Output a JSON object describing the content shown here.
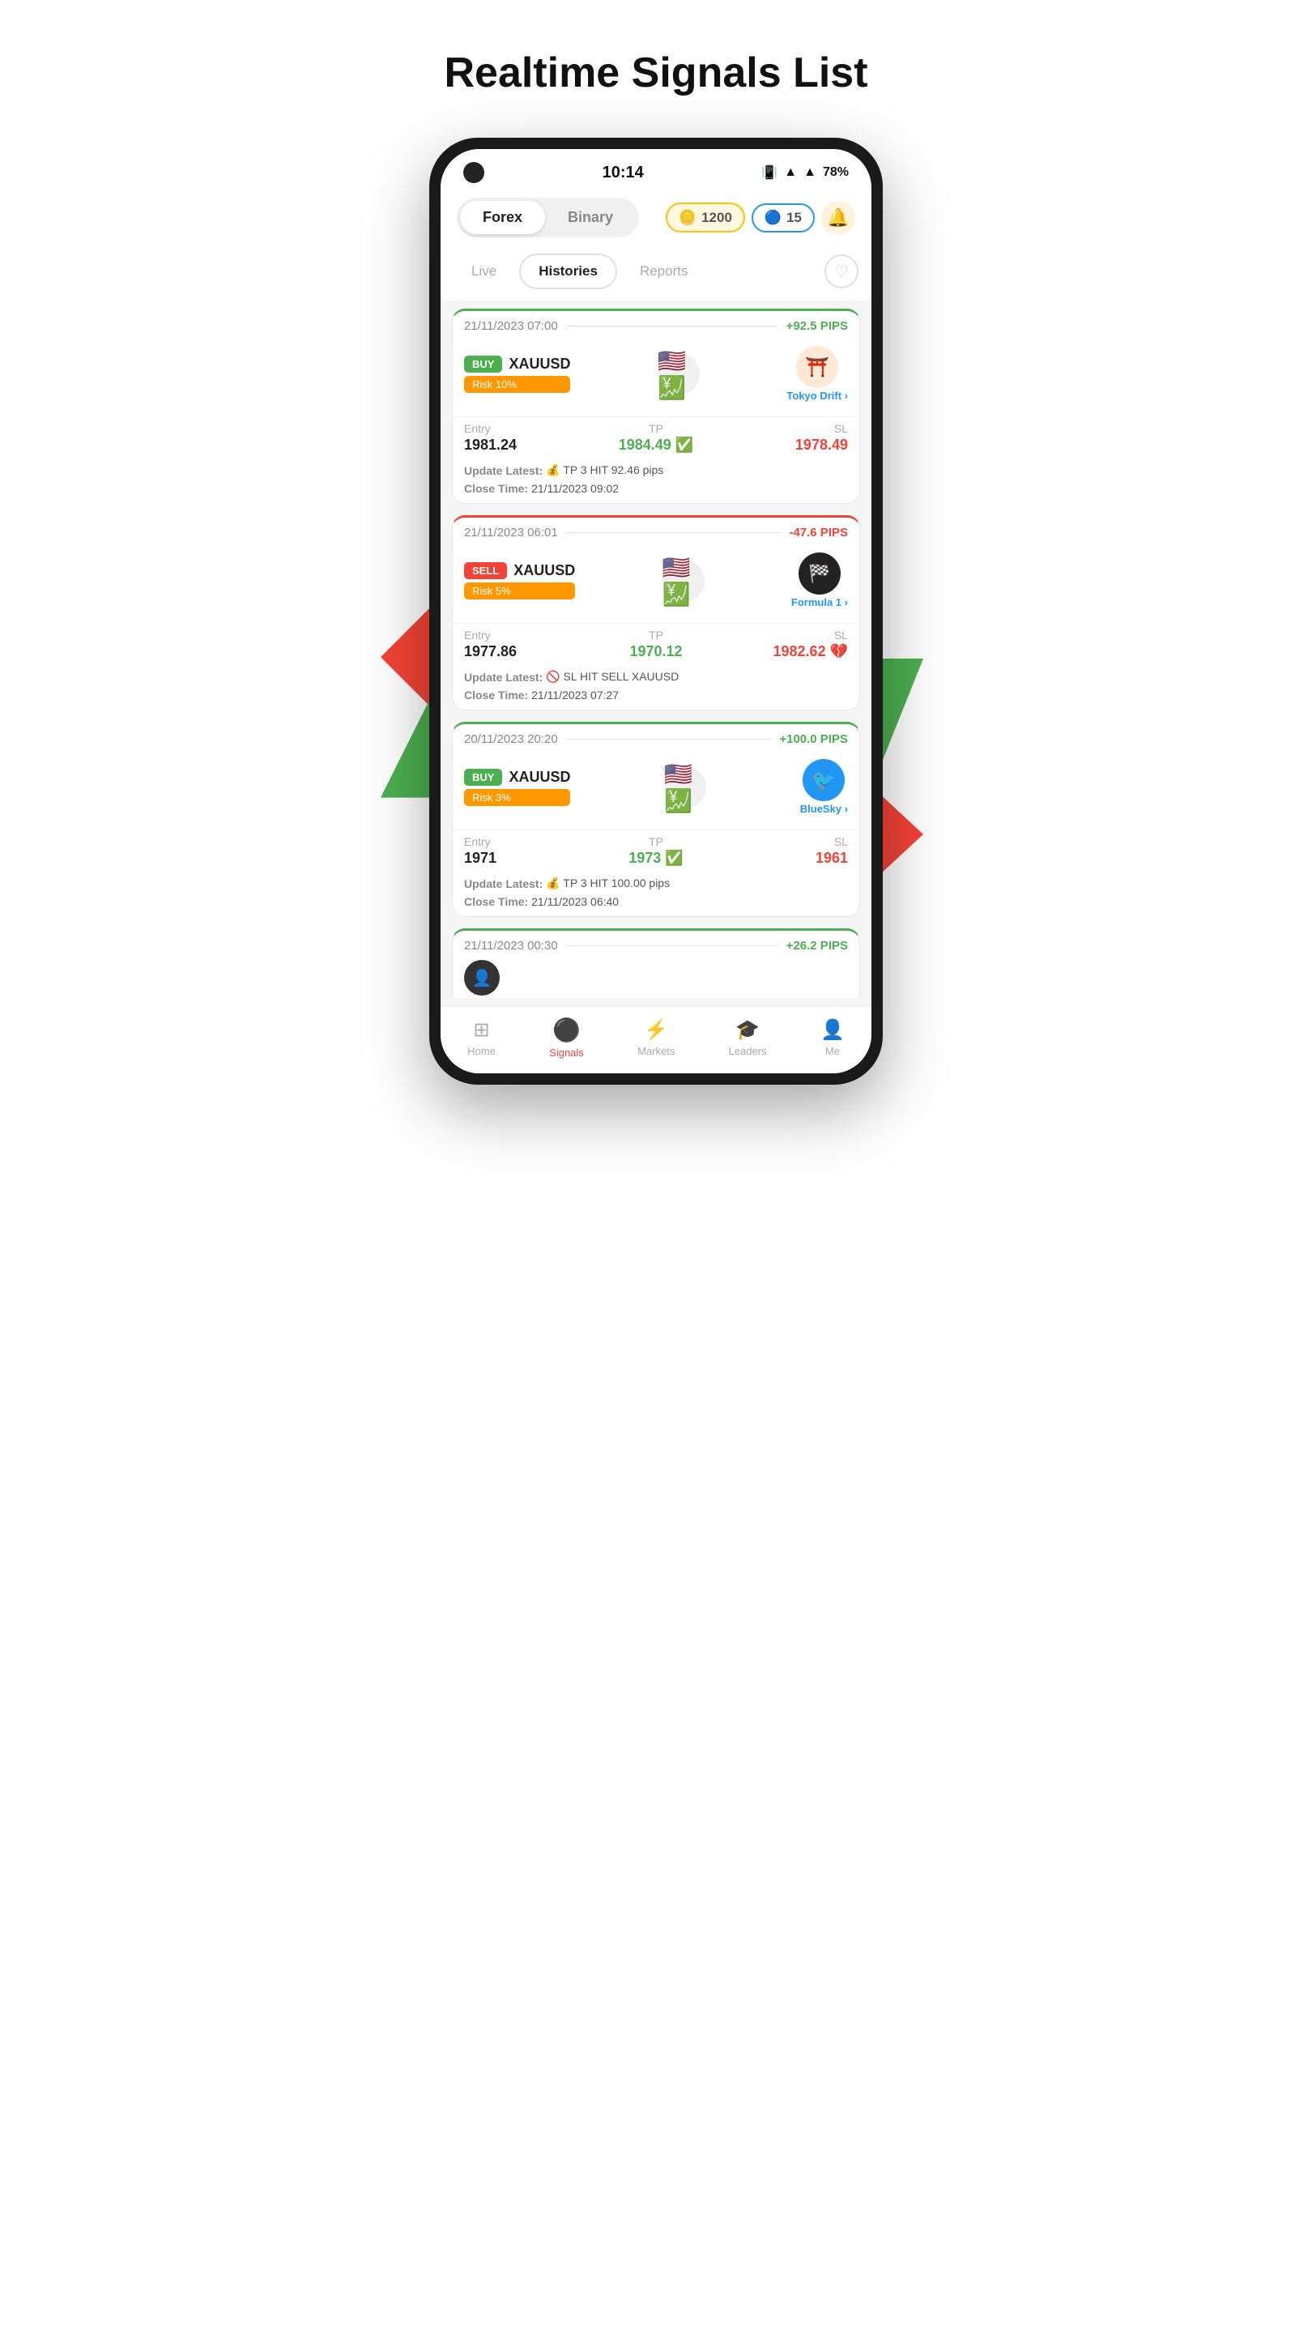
{
  "page": {
    "title": "Realtime Signals List"
  },
  "statusBar": {
    "time": "10:14",
    "battery": "78%"
  },
  "topTabs": {
    "items": [
      {
        "label": "Forex",
        "active": true
      },
      {
        "label": "Binary",
        "active": false
      }
    ],
    "coins": "1200",
    "followers": "15"
  },
  "subTabs": {
    "items": [
      {
        "label": "Live",
        "active": false
      },
      {
        "label": "Histories",
        "active": true
      },
      {
        "label": "Reports",
        "active": false
      }
    ]
  },
  "signals": [
    {
      "date": "21/11/2023 07:00",
      "pips": "+92.5 PIPS",
      "pipsType": "positive",
      "direction": "BUY",
      "pair": "XAUUSD",
      "risk": "Risk 10%",
      "provider": "Tokyo Drift",
      "providerEmoji": "⛩️",
      "flagEmoji": "🇺🇸",
      "entry": "1981.24",
      "tp": "1984.49 ✅",
      "sl": "1978.49",
      "tpColor": "green",
      "slColor": "red",
      "updateText": "💰 TP 3 HIT 92.46 pips",
      "closeTime": "21/11/2023 09:02"
    },
    {
      "date": "21/11/2023 06:01",
      "pips": "-47.6 PIPS",
      "pipsType": "negative",
      "direction": "SELL",
      "pair": "XAUUSD",
      "risk": "Risk 5%",
      "provider": "Formula 1",
      "providerEmoji": "🏎️",
      "flagEmoji": "🇺🇸",
      "entry": "1977.86",
      "tp": "1970.12",
      "sl": "1982.62 💔",
      "tpColor": "green",
      "slColor": "red",
      "updateText": "🚫 SL HIT SELL XAUUSD",
      "closeTime": "21/11/2023 07:27"
    },
    {
      "date": "20/11/2023 20:20",
      "pips": "+100.0 PIPS",
      "pipsType": "positive",
      "direction": "BUY",
      "pair": "XAUUSD",
      "risk": "Risk 3%",
      "provider": "BlueSky",
      "providerEmoji": "🐦",
      "flagEmoji": "🇺🇸",
      "entry": "1971",
      "tp": "1973 ✅",
      "sl": "1961",
      "tpColor": "green",
      "slColor": "red",
      "updateText": "💰 TP 3 HIT 100.00 pips",
      "closeTime": "21/11/2023 06:40"
    }
  ],
  "partialSignal": {
    "date": "21/11/2023 00:30",
    "pips": "+26.2 PIPS",
    "pipsType": "positive"
  },
  "bottomNav": {
    "items": [
      {
        "label": "Home",
        "icon": "⊞",
        "active": false
      },
      {
        "label": "Signals",
        "icon": "●",
        "active": true
      },
      {
        "label": "Markets",
        "icon": "⚡",
        "active": false
      },
      {
        "label": "Leaders",
        "icon": "🎓",
        "active": false
      },
      {
        "label": "Me",
        "icon": "👤",
        "active": false
      }
    ]
  }
}
